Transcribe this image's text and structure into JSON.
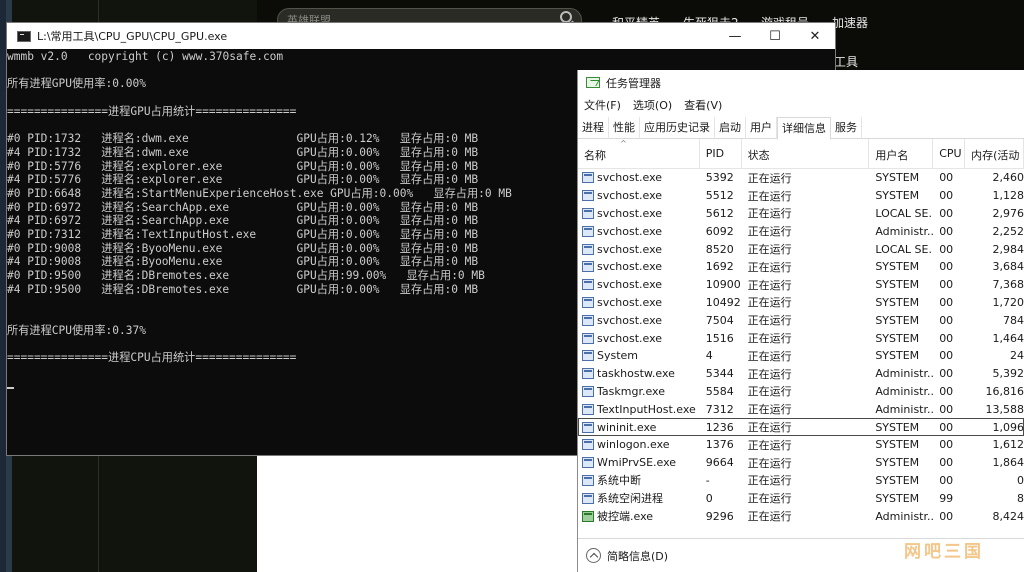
{
  "background": {
    "search_placeholder": "英雄联盟",
    "nav": [
      "和平精英",
      "生死狙击2",
      "游戏租号",
      "加速器"
    ],
    "tools_label": "用工具"
  },
  "console": {
    "title": "L:\\常用工具\\CPU_GPU\\CPU_GPU.exe",
    "lines": [
      "wmmb v2.0   copyright (c) www.370safe.com",
      "",
      "所有进程GPU使用率:0.00%",
      "",
      "===============进程GPU占用统计===============",
      "",
      "#0 PID:1732   进程名:dwm.exe                GPU占用:0.12%   显存占用:0 MB",
      "#4 PID:1732   进程名:dwm.exe                GPU占用:0.00%   显存占用:0 MB",
      "#0 PID:5776   进程名:explorer.exe           GPU占用:0.00%   显存占用:0 MB",
      "#4 PID:5776   进程名:explorer.exe           GPU占用:0.00%   显存占用:0 MB",
      "#0 PID:6648   进程名:StartMenuExperienceHost.exe GPU占用:0.00%   显存占用:0 MB",
      "#0 PID:6972   进程名:SearchApp.exe          GPU占用:0.00%   显存占用:0 MB",
      "#4 PID:6972   进程名:SearchApp.exe          GPU占用:0.00%   显存占用:0 MB",
      "#0 PID:7312   进程名:TextInputHost.exe      GPU占用:0.00%   显存占用:0 MB",
      "#0 PID:9008   进程名:ByooMenu.exe           GPU占用:0.00%   显存占用:0 MB",
      "#4 PID:9008   进程名:ByooMenu.exe           GPU占用:0.00%   显存占用:0 MB",
      "#0 PID:9500   进程名:DBremotes.exe          GPU占用:99.00%   显存占用:0 MB",
      "#4 PID:9500   进程名:DBremotes.exe          GPU占用:0.00%   显存占用:0 MB",
      "",
      "",
      "所有进程CPU使用率:0.37%",
      "",
      "===============进程CPU占用统计==============="
    ]
  },
  "taskmgr": {
    "title": "任务管理器",
    "menu": [
      "文件(F)",
      "选项(O)",
      "查看(V)"
    ],
    "tabs": [
      "进程",
      "性能",
      "应用历史记录",
      "启动",
      "用户",
      "详细信息",
      "服务"
    ],
    "active_tab": "详细信息",
    "columns": [
      "名称",
      "PID",
      "状态",
      "用户名",
      "CPU",
      "内存(活动"
    ],
    "rows": [
      {
        "name": "svchost.exe",
        "pid": "5392",
        "status": "正在运行",
        "user": "SYSTEM",
        "cpu": "00",
        "mem": "2,460"
      },
      {
        "name": "svchost.exe",
        "pid": "5512",
        "status": "正在运行",
        "user": "SYSTEM",
        "cpu": "00",
        "mem": "1,128"
      },
      {
        "name": "svchost.exe",
        "pid": "5612",
        "status": "正在运行",
        "user": "LOCAL SE...",
        "cpu": "00",
        "mem": "2,976"
      },
      {
        "name": "svchost.exe",
        "pid": "6092",
        "status": "正在运行",
        "user": "Administr...",
        "cpu": "00",
        "mem": "2,252"
      },
      {
        "name": "svchost.exe",
        "pid": "8520",
        "status": "正在运行",
        "user": "LOCAL SE...",
        "cpu": "00",
        "mem": "2,984"
      },
      {
        "name": "svchost.exe",
        "pid": "1692",
        "status": "正在运行",
        "user": "SYSTEM",
        "cpu": "00",
        "mem": "3,684"
      },
      {
        "name": "svchost.exe",
        "pid": "10900",
        "status": "正在运行",
        "user": "SYSTEM",
        "cpu": "00",
        "mem": "7,368"
      },
      {
        "name": "svchost.exe",
        "pid": "10492",
        "status": "正在运行",
        "user": "SYSTEM",
        "cpu": "00",
        "mem": "1,720"
      },
      {
        "name": "svchost.exe",
        "pid": "7504",
        "status": "正在运行",
        "user": "SYSTEM",
        "cpu": "00",
        "mem": "784"
      },
      {
        "name": "svchost.exe",
        "pid": "1516",
        "status": "正在运行",
        "user": "SYSTEM",
        "cpu": "00",
        "mem": "1,464"
      },
      {
        "name": "System",
        "pid": "4",
        "status": "正在运行",
        "user": "SYSTEM",
        "cpu": "00",
        "mem": "24"
      },
      {
        "name": "taskhostw.exe",
        "pid": "5344",
        "status": "正在运行",
        "user": "Administr...",
        "cpu": "00",
        "mem": "5,392"
      },
      {
        "name": "Taskmgr.exe",
        "pid": "5584",
        "status": "正在运行",
        "user": "Administr...",
        "cpu": "00",
        "mem": "16,816"
      },
      {
        "name": "TextInputHost.exe",
        "pid": "7312",
        "status": "正在运行",
        "user": "Administr...",
        "cpu": "00",
        "mem": "13,588"
      },
      {
        "name": "wininit.exe",
        "pid": "1236",
        "status": "正在运行",
        "user": "SYSTEM",
        "cpu": "00",
        "mem": "1,096"
      },
      {
        "name": "winlogon.exe",
        "pid": "1376",
        "status": "正在运行",
        "user": "SYSTEM",
        "cpu": "00",
        "mem": "1,612"
      },
      {
        "name": "WmiPrvSE.exe",
        "pid": "9664",
        "status": "正在运行",
        "user": "SYSTEM",
        "cpu": "00",
        "mem": "1,864"
      },
      {
        "name": "系统中断",
        "pid": "-",
        "status": "正在运行",
        "user": "SYSTEM",
        "cpu": "00",
        "mem": "0"
      },
      {
        "name": "系统空闲进程",
        "pid": "0",
        "status": "正在运行",
        "user": "SYSTEM",
        "cpu": "99",
        "mem": "8"
      },
      {
        "name": "被控端.exe",
        "pid": "9296",
        "status": "正在运行",
        "user": "Administr...",
        "cpu": "00",
        "mem": "8,424"
      }
    ],
    "selected_row": "wininit.exe",
    "footer": "简略信息(D)"
  },
  "watermark": "网吧三国"
}
